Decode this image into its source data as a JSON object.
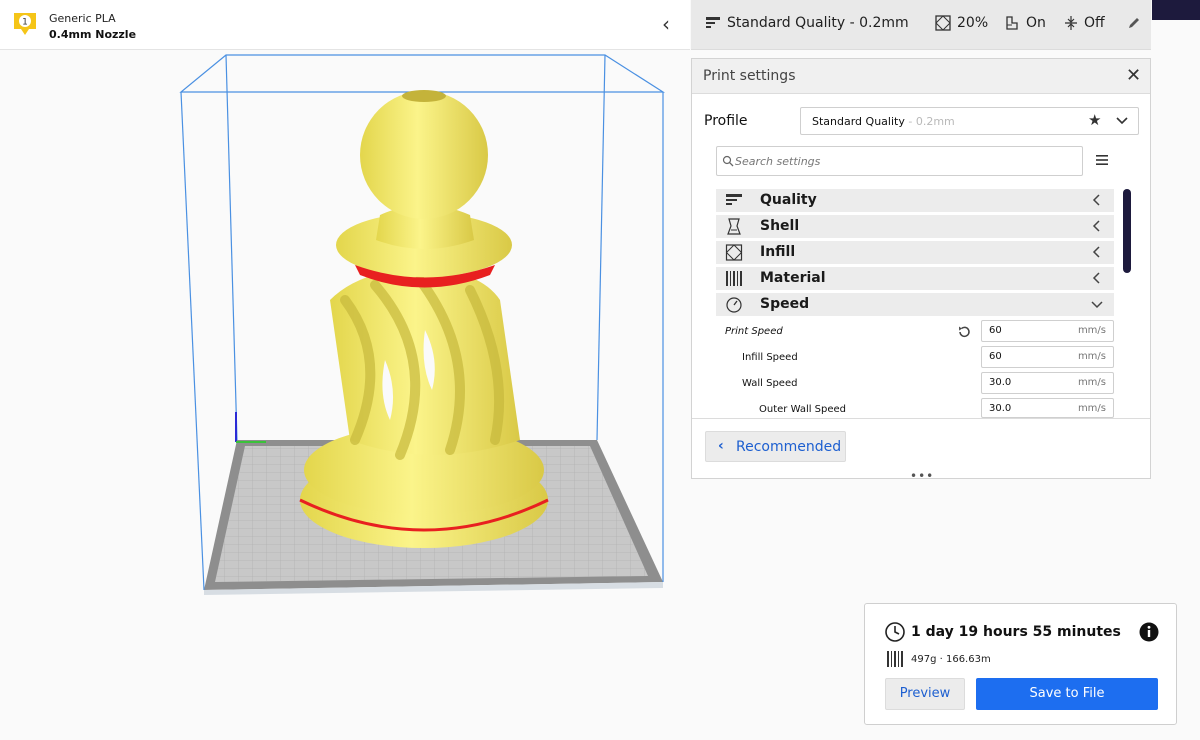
{
  "header": {
    "material_name": "Generic PLA",
    "nozzle": "0.4mm Nozzle",
    "extruder_number": "1",
    "quality_summary": "Standard Quality - 0.2mm",
    "infill_summary": "20%",
    "support_summary": "On",
    "adhesion_summary": "Off"
  },
  "print_settings": {
    "title": "Print settings",
    "profile_label": "Profile",
    "profile_name": "Standard Quality",
    "profile_suffix": " - 0.2mm",
    "search_placeholder": "Search settings",
    "categories": [
      {
        "label": "Quality",
        "icon": "quality-icon",
        "expanded": false
      },
      {
        "label": "Shell",
        "icon": "shell-icon",
        "expanded": false
      },
      {
        "label": "Infill",
        "icon": "infill-icon",
        "expanded": false
      },
      {
        "label": "Material",
        "icon": "material-icon",
        "expanded": false
      },
      {
        "label": "Speed",
        "icon": "speed-icon",
        "expanded": true
      }
    ],
    "settings": [
      {
        "label": "Print Speed",
        "value": "60",
        "unit": "mm/s"
      },
      {
        "label": "Infill Speed",
        "value": "60",
        "unit": "mm/s"
      },
      {
        "label": "Wall Speed",
        "value": "30.0",
        "unit": "mm/s"
      },
      {
        "label": "Outer Wall Speed",
        "value": "30.0",
        "unit": "mm/s"
      }
    ],
    "recommended_label": "Recommended"
  },
  "action_panel": {
    "print_time": "1 day 19 hours 55 minutes",
    "material_amount": "497g · 166.63m",
    "preview_label": "Preview",
    "save_label": "Save to File"
  },
  "colors": {
    "accent_blue": "#1d6ef0",
    "model_yellow": "#f2e66a",
    "overhang_red": "#e82020",
    "scrollbar": "#1d1a3d",
    "badge_yellow": "#f5c518"
  }
}
